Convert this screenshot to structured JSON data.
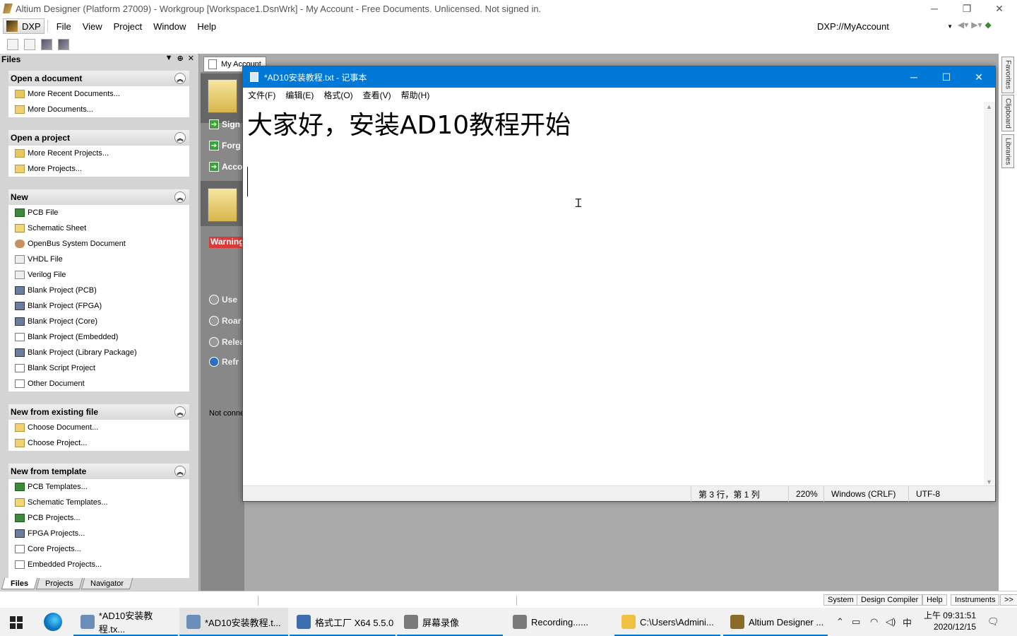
{
  "window": {
    "title": "Altium Designer (Platform 27009) - Workgroup [Workspace1.DsnWrk] - My Account - Free Documents. Unlicensed. Not signed in."
  },
  "menubar": {
    "dxp": "DXP",
    "items": [
      "File",
      "View",
      "Project",
      "Window",
      "Help"
    ],
    "address": "DXP://MyAccount"
  },
  "files_panel": {
    "title": "Files",
    "sections": [
      {
        "title": "Open a document",
        "items": [
          {
            "label": "More Recent Documents...",
            "icon": "folder"
          },
          {
            "label": "More Documents...",
            "icon": "folder-open"
          }
        ]
      },
      {
        "title": "Open a project",
        "items": [
          {
            "label": "More Recent Projects...",
            "icon": "folder"
          },
          {
            "label": "More Projects...",
            "icon": "folder-open"
          }
        ]
      },
      {
        "title": "New",
        "items": [
          {
            "label": "PCB File",
            "icon": "pcb"
          },
          {
            "label": "Schematic Sheet",
            "icon": "sch"
          },
          {
            "label": "OpenBus System Document",
            "icon": "bus"
          },
          {
            "label": "VHDL File",
            "icon": "vhdl"
          },
          {
            "label": "Verilog File",
            "icon": "vhdl"
          },
          {
            "label": "Blank Project (PCB)",
            "icon": "proj"
          },
          {
            "label": "Blank Project (FPGA)",
            "icon": "proj"
          },
          {
            "label": "Blank Project (Core)",
            "icon": "proj"
          },
          {
            "label": "Blank Project (Embedded)",
            "icon": "doc"
          },
          {
            "label": "Blank Project (Library Package)",
            "icon": "proj"
          },
          {
            "label": "Blank Script Project",
            "icon": "doc"
          },
          {
            "label": "Other Document",
            "icon": "doc"
          }
        ]
      },
      {
        "title": "New from existing file",
        "items": [
          {
            "label": "Choose Document...",
            "icon": "folder-open"
          },
          {
            "label": "Choose Project...",
            "icon": "folder-open"
          }
        ]
      },
      {
        "title": "New from template",
        "items": [
          {
            "label": "PCB Templates...",
            "icon": "pcb"
          },
          {
            "label": "Schematic Templates...",
            "icon": "sch"
          },
          {
            "label": "PCB Projects...",
            "icon": "pcb"
          },
          {
            "label": "FPGA Projects...",
            "icon": "proj"
          },
          {
            "label": "Core Projects...",
            "icon": "doc"
          },
          {
            "label": "Embedded Projects...",
            "icon": "doc"
          }
        ]
      }
    ],
    "tabs": [
      "Files",
      "Projects",
      "Navigator"
    ]
  },
  "account_doc": {
    "tab": "My Account",
    "links": [
      "Sign",
      "Forg",
      "Acco"
    ],
    "warning": "Warning",
    "grey_links": [
      "Use",
      "Roar",
      "Relea",
      "Refr"
    ],
    "not_connected": "Not conne"
  },
  "right_bar": {
    "tabs": [
      "Favorites",
      "Clipboard",
      "Libraries"
    ]
  },
  "notepad": {
    "title": "*AD10安装教程.txt - 记事本",
    "menu": [
      "文件(F)",
      "编辑(E)",
      "格式(O)",
      "查看(V)",
      "帮助(H)"
    ],
    "content": "大家好，安装AD10教程开始",
    "status": {
      "position": "第 3 行，第 1 列",
      "zoom": "220%",
      "line_ending": "Windows (CRLF)",
      "encoding": "UTF-8"
    }
  },
  "ad_status_buttons": [
    "System",
    "Design Compiler",
    "Help",
    "Instruments",
    ">>"
  ],
  "taskbar": {
    "tasks": [
      {
        "label": "*AD10安装教程.tx...",
        "color": "#6b8fb8"
      },
      {
        "label": "*AD10安装教程.t...",
        "color": "#6b8fb8"
      },
      {
        "label": "格式工厂 X64 5.5.0",
        "color": "#3d6fb0"
      },
      {
        "label": "屏幕录像",
        "color": "#7a7a7a"
      },
      {
        "label": "Recording......",
        "color": "#7a7a7a"
      },
      {
        "label": "C:\\Users\\Admini...",
        "color": "#f0c040"
      },
      {
        "label": "Altium Designer ...",
        "color": "#8a6b2a"
      }
    ],
    "ime": "中",
    "time": "上午 09:31:51",
    "date": "2020/12/15"
  }
}
